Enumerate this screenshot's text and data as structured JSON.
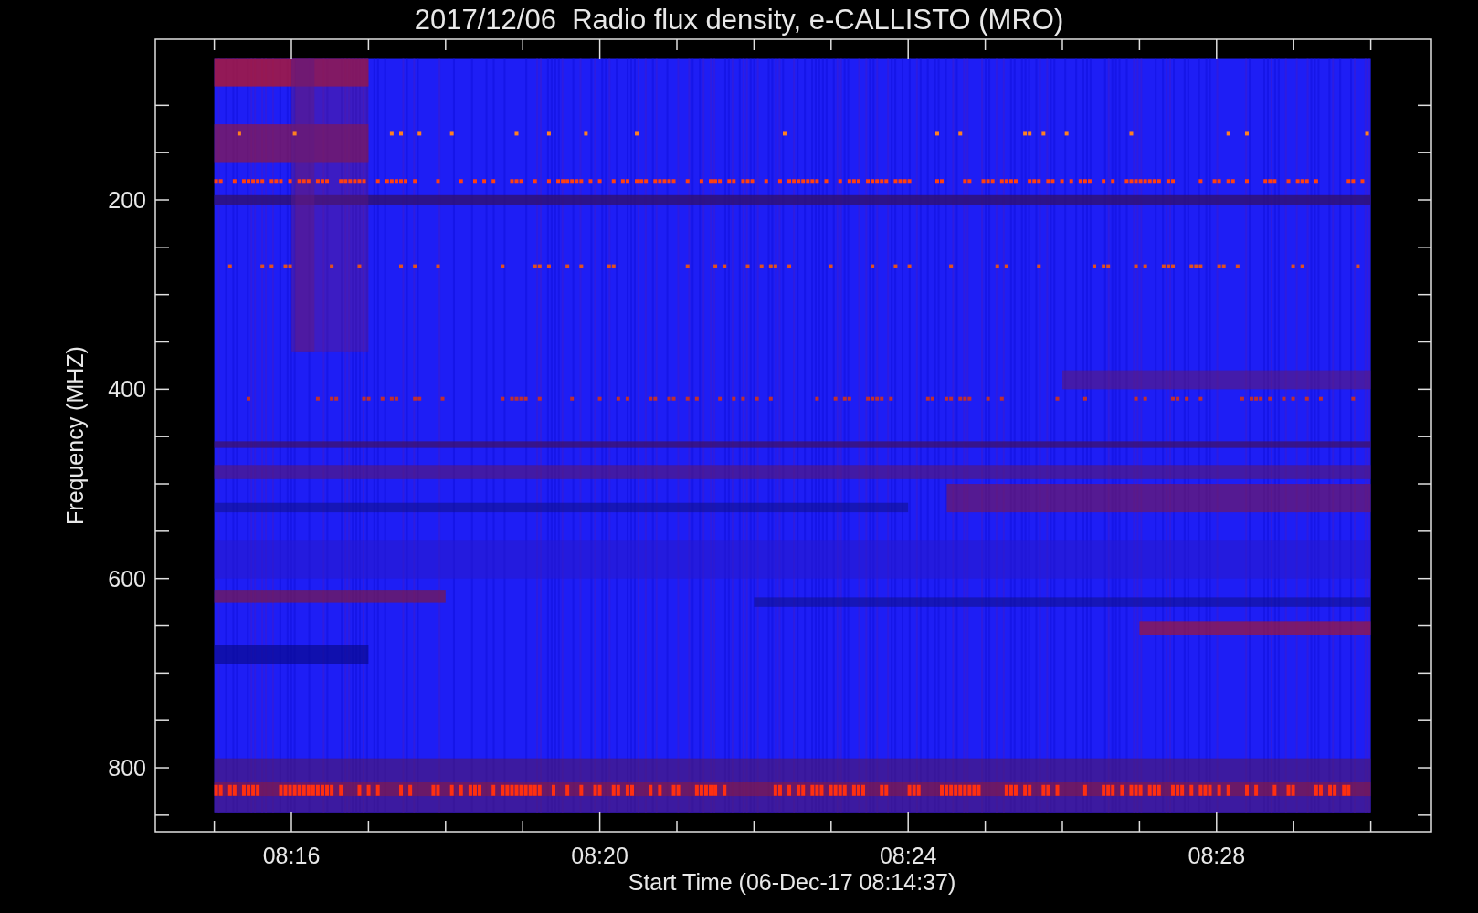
{
  "title": "2017/12/06  Radio flux density, e-CALLISTO (MRO)",
  "y_axis": {
    "label": "Frequency (MHZ)",
    "ticks": [
      "200",
      "400",
      "600",
      "800"
    ]
  },
  "x_axis": {
    "label": "Start Time (06-Dec-17 08:14:37)",
    "ticks": [
      "08:16",
      "08:20",
      "08:24",
      "08:28"
    ]
  }
}
